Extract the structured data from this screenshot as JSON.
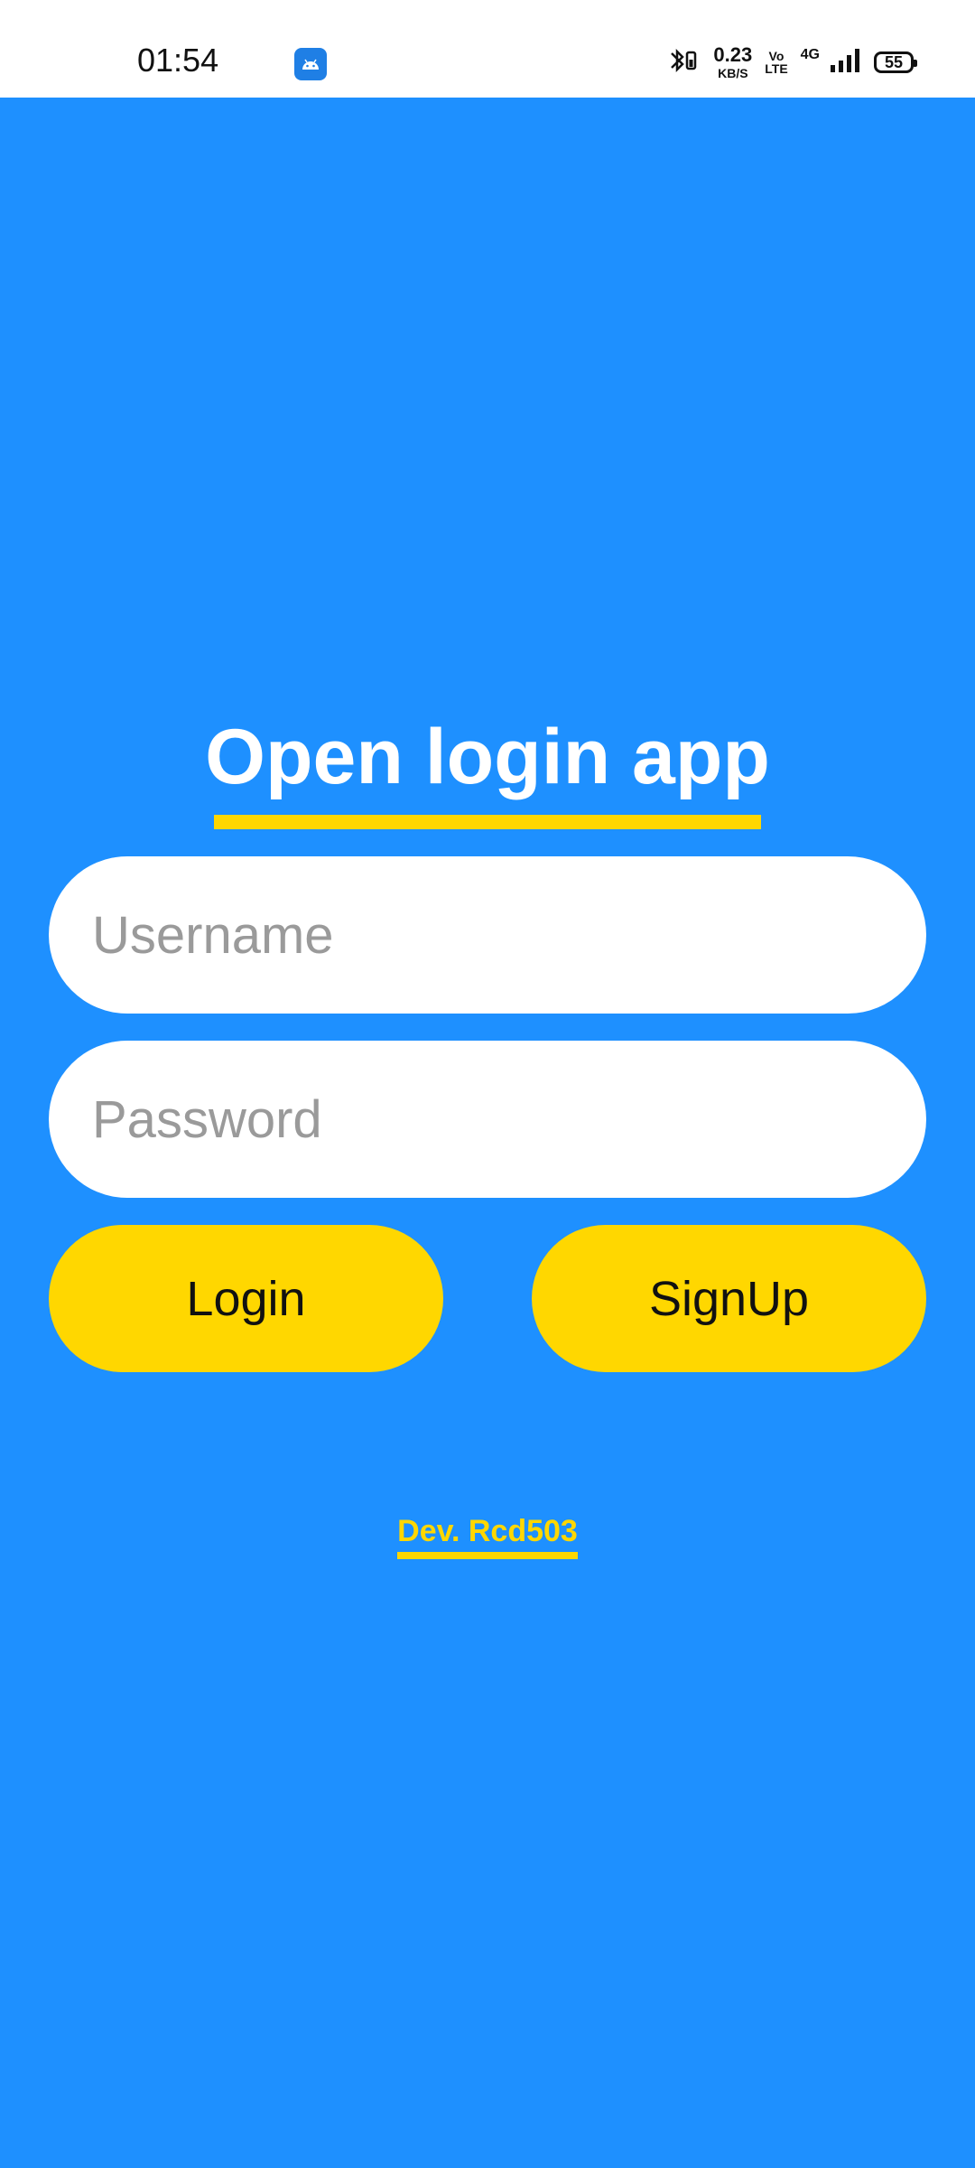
{
  "status_bar": {
    "time": "01:54",
    "net_speed_value": "0.23",
    "net_speed_unit": "KB/S",
    "volte_top": "Vo",
    "volte_bottom": "LTE",
    "network": "4G",
    "battery": "55",
    "app_icon": "android-icon",
    "bluetooth_icon": "bluetooth-icon",
    "signal_icon": "signal-icon"
  },
  "login": {
    "title": "Open login app",
    "username_placeholder": "Username",
    "username_value": "",
    "password_placeholder": "Password",
    "password_value": "",
    "login_label": "Login",
    "signup_label": "SignUp",
    "dev_label": "Dev. Rcd503"
  },
  "colors": {
    "background": "#1e90ff",
    "accent": "#ffd700",
    "title_text": "#ffffff",
    "input_background": "#ffffff"
  }
}
